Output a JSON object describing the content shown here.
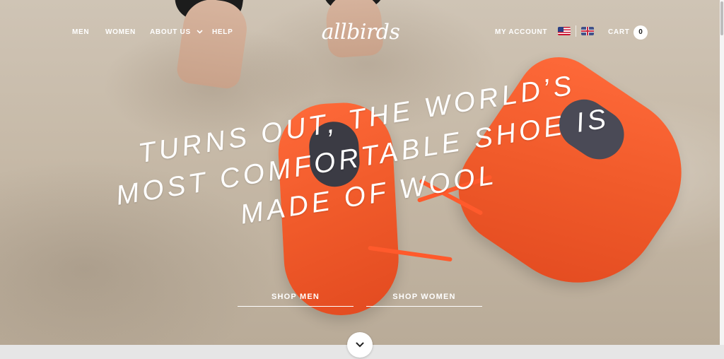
{
  "nav": {
    "men": "MEN",
    "women": "WOMEN",
    "about_us": "ABOUT US",
    "help": "HELP",
    "my_account": "MY ACCOUNT",
    "cart": "CART",
    "cart_count": "0"
  },
  "logo_text": "allbirds",
  "flags": {
    "us": "us-flag-icon",
    "uk": "uk-flag-icon"
  },
  "hero": {
    "headline_line1": "TURNS OUT, THE WORLD’S",
    "headline_line2": "MOST COMFORTABLE SHOE IS",
    "headline_line3": "MADE OF WOOL",
    "shop_men": "SHOP MEN",
    "shop_women": "SHOP WOMEN"
  },
  "icons": {
    "about_chevron": "chevron-down-icon",
    "scroll_down": "chevron-down-icon"
  },
  "colors": {
    "shoe_orange": "#f05a2a",
    "sand": "#c6b9a7",
    "text": "#ffffff"
  }
}
